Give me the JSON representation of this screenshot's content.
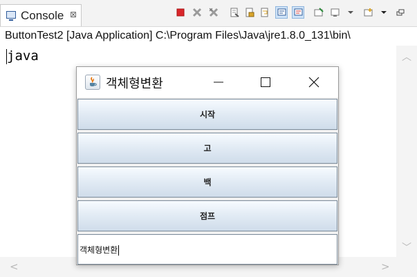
{
  "console": {
    "tab_label": "Console",
    "tab_close": "⊠",
    "launch_line": "ButtonTest2 [Java Application] C:\\Program Files\\Java\\jre1.8.0_131\\bin\\",
    "output": "java"
  },
  "window": {
    "title": "객체형변환",
    "buttons": {
      "start": "시작",
      "go": "고",
      "back": "백",
      "jump": "점프"
    },
    "text_field_value": "객체형변환"
  },
  "colors": {
    "accent": "#2f5b9a",
    "terminate": "#d9262b"
  }
}
